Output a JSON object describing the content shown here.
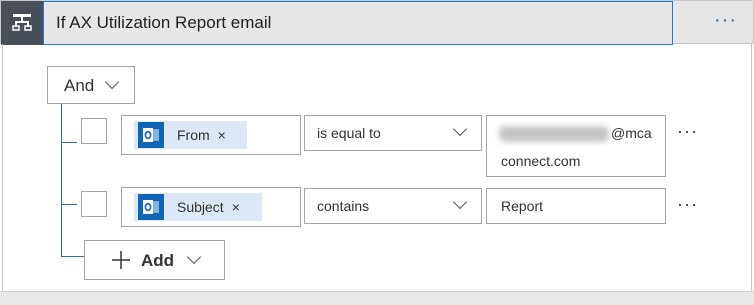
{
  "header": {
    "title": "If AX Utilization Report email",
    "more_label": "···",
    "icon": "condition-icon"
  },
  "group": {
    "operator_label": "And"
  },
  "rows": [
    {
      "field_token": "From",
      "token_remove": "×",
      "token_icon": "outlook-icon",
      "operator": "is equal to",
      "value_line1_suffix": "@mca",
      "value_line2": "connect.com",
      "more_label": "···"
    },
    {
      "field_token": "Subject",
      "token_remove": "×",
      "token_icon": "outlook-icon",
      "operator": "contains",
      "value": "Report",
      "more_label": "···"
    }
  ],
  "add_button": {
    "label": "Add"
  },
  "colors": {
    "accent": "#2f6fb3",
    "outlook": "#0f64b6",
    "header_bg": "#e6e6e6",
    "icon_bg": "#484f58"
  }
}
